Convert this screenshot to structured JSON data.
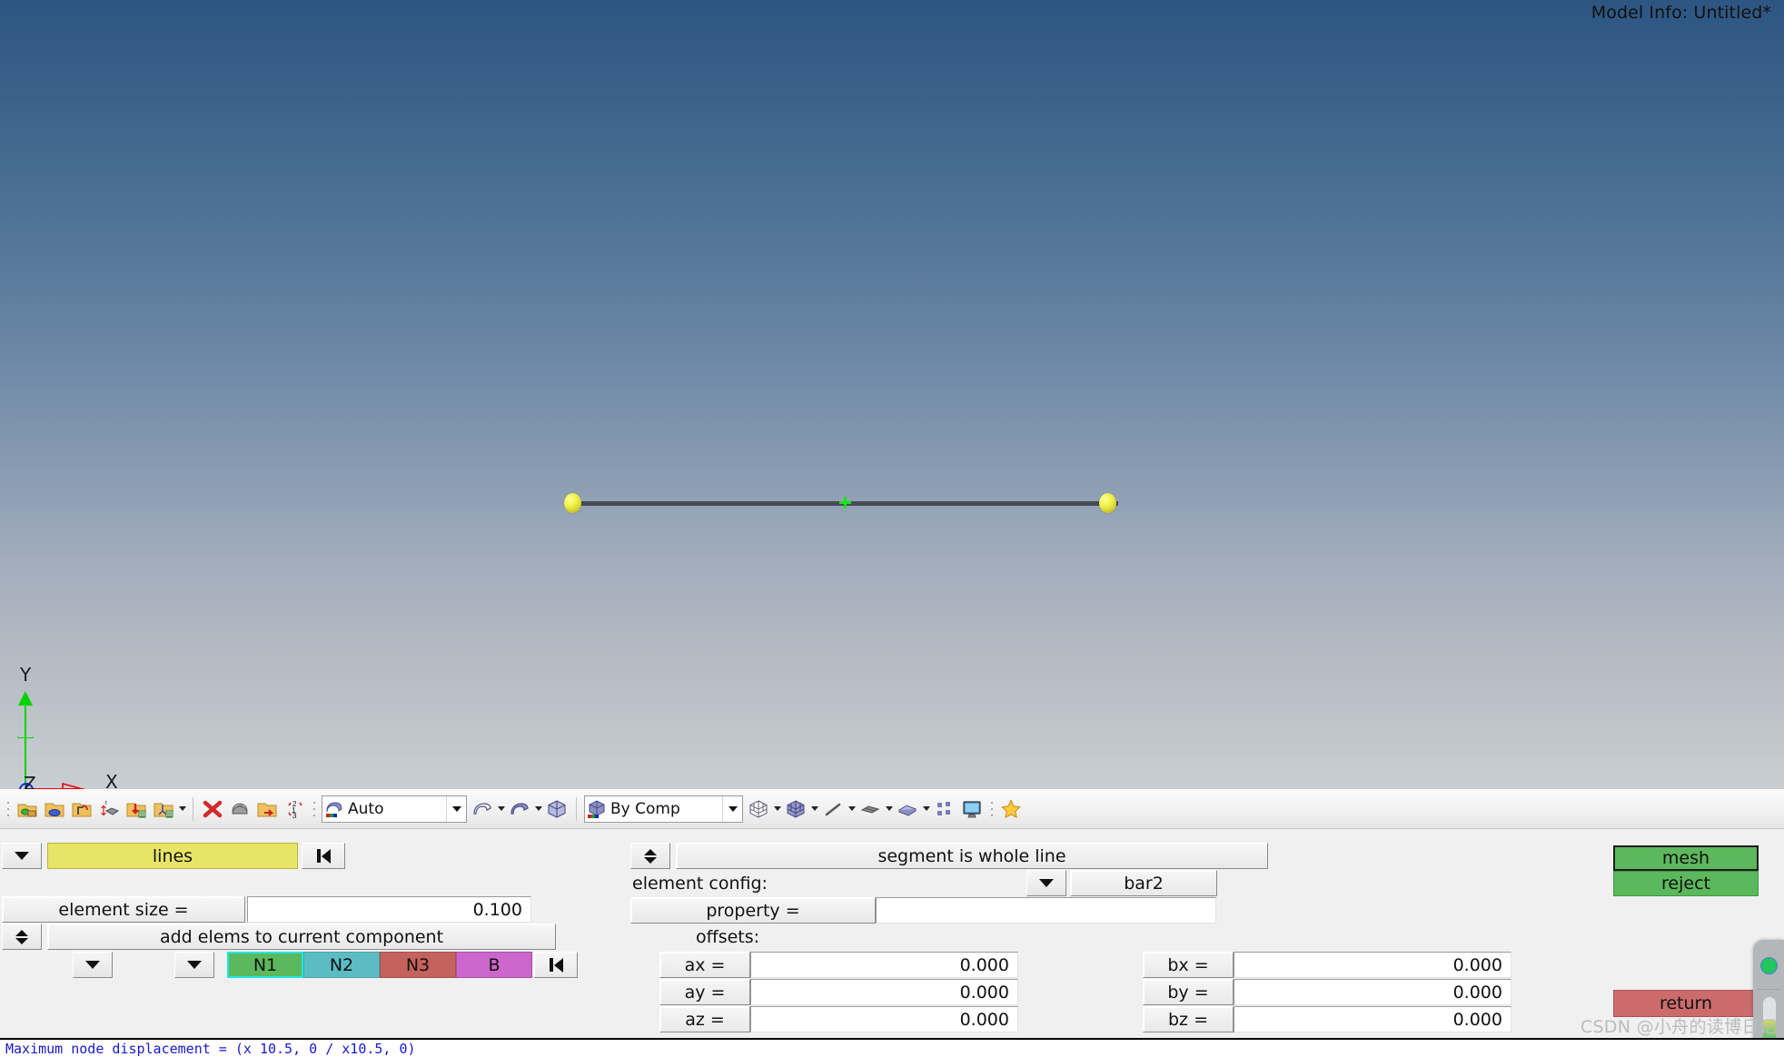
{
  "viewport": {
    "model_info": "Model Info: Untitled*",
    "axis_labels": {
      "x": "X",
      "y": "Y",
      "z": "Z"
    },
    "background_top_color": "#2d5582",
    "background_bottom_color": "#c9ced3",
    "geometry": {
      "type": "bar2-line",
      "line_color": "#474c52",
      "node_color": "#f2f24a",
      "midpoint_marker_color": "#17e417",
      "node_count": 2
    }
  },
  "toolbar": {
    "groups": [
      {
        "name": "component-tools",
        "icons": [
          "component-create-icon",
          "component-edit-icon",
          "component-delete-organize-icon",
          "component-translate-icon",
          "component-import-icon",
          "component-assembly-icon"
        ],
        "has_caret": true
      },
      {
        "name": "delete-tools",
        "icons": [
          "delete-red-x-icon",
          "mask-icon",
          "organize-folder-icon",
          "renumber-icon"
        ]
      }
    ],
    "mesh_mode_combo": {
      "icon": "surface-mesh-icon",
      "value": "Auto"
    },
    "geometry_icons": [
      "surface-outline-icon",
      "surface-shaded-icon",
      "solid-cube-icon"
    ],
    "color_mode_combo": {
      "icon": "cube-color-icon",
      "value": "By Comp"
    },
    "display_icons": [
      "wireframe-cube-icon",
      "shaded-cube-icon",
      "line-element-icon",
      "shell-element-icon",
      "solid-element-icon",
      "node-display-icon",
      "monitor-icon"
    ],
    "favorite_icon": "star-icon"
  },
  "panel": {
    "left_column": {
      "entity_selector": {
        "arrow_icon": "chevron-down-icon",
        "value": "lines",
        "reset_icon": "rewind-to-start-icon"
      },
      "element_size": {
        "label": "element size =",
        "value": "0.100"
      },
      "component_mode": {
        "toggle_icon": "up-down-arrows-icon",
        "value": "add elems to current component"
      },
      "node_row": {
        "arrow_icon_1": "chevron-down-icon",
        "arrow_icon_2": "chevron-down-icon",
        "buttons": [
          {
            "label": "N1",
            "color": "#5cb85c",
            "selected": true
          },
          {
            "label": "N2",
            "color": "#5cbcc4",
            "selected": false
          },
          {
            "label": "N3",
            "color": "#c4625c",
            "selected": false
          },
          {
            "label": "B",
            "color": "#cc66cc",
            "selected": false
          }
        ],
        "reset_icon": "rewind-to-start-icon"
      }
    },
    "center_column": {
      "segment_mode": {
        "toggle_icon": "up-down-arrows-icon",
        "value": "segment is whole line"
      },
      "element_config": {
        "label": "element config:",
        "arrow_icon": "chevron-down-icon",
        "value": "bar2"
      },
      "property": {
        "label": "property =",
        "value": ""
      },
      "offsets_label": "offsets:",
      "offsets_a": [
        {
          "label": "ax =",
          "value": "0.000"
        },
        {
          "label": "ay =",
          "value": "0.000"
        },
        {
          "label": "az =",
          "value": "0.000"
        }
      ],
      "offsets_b": [
        {
          "label": "bx =",
          "value": "0.000"
        },
        {
          "label": "by =",
          "value": "0.000"
        },
        {
          "label": "bz =",
          "value": "0.000"
        }
      ]
    },
    "right_column": {
      "mesh_button": {
        "label": "mesh",
        "color": "#5cb85c"
      },
      "reject_button": {
        "label": "reject",
        "color": "#5cb85c"
      },
      "return_button": {
        "label": "return",
        "color": "#cc6b6b"
      }
    }
  },
  "side_widget": {
    "status_dot_color": "#22c55e",
    "scroll_icon": "chevron-down-icon"
  },
  "statusbar": {
    "text": "Maximum node displacement = (x 10.5, 0 / x10.5, 0)"
  },
  "watermark": "CSDN @小舟的读博日记"
}
